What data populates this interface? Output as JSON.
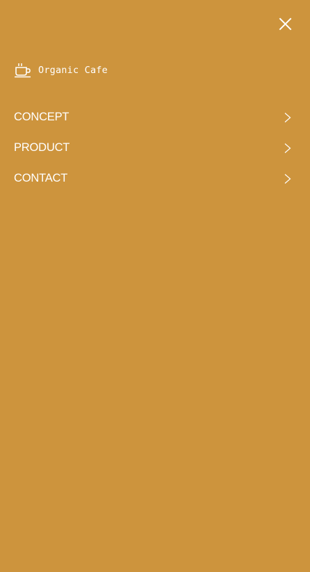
{
  "menu": {
    "close_icon": "close-icon",
    "brand": {
      "icon": "coffee-cup-icon",
      "name": "Organic Cafe"
    },
    "items": [
      {
        "label": "CONCEPT",
        "icon": "chevron-right-icon"
      },
      {
        "label": "PRODUCT",
        "icon": "chevron-right-icon"
      },
      {
        "label": "CONTACT",
        "icon": "chevron-right-icon"
      }
    ]
  },
  "colors": {
    "background": "#CD943D",
    "foreground": "#FFFFFF"
  }
}
